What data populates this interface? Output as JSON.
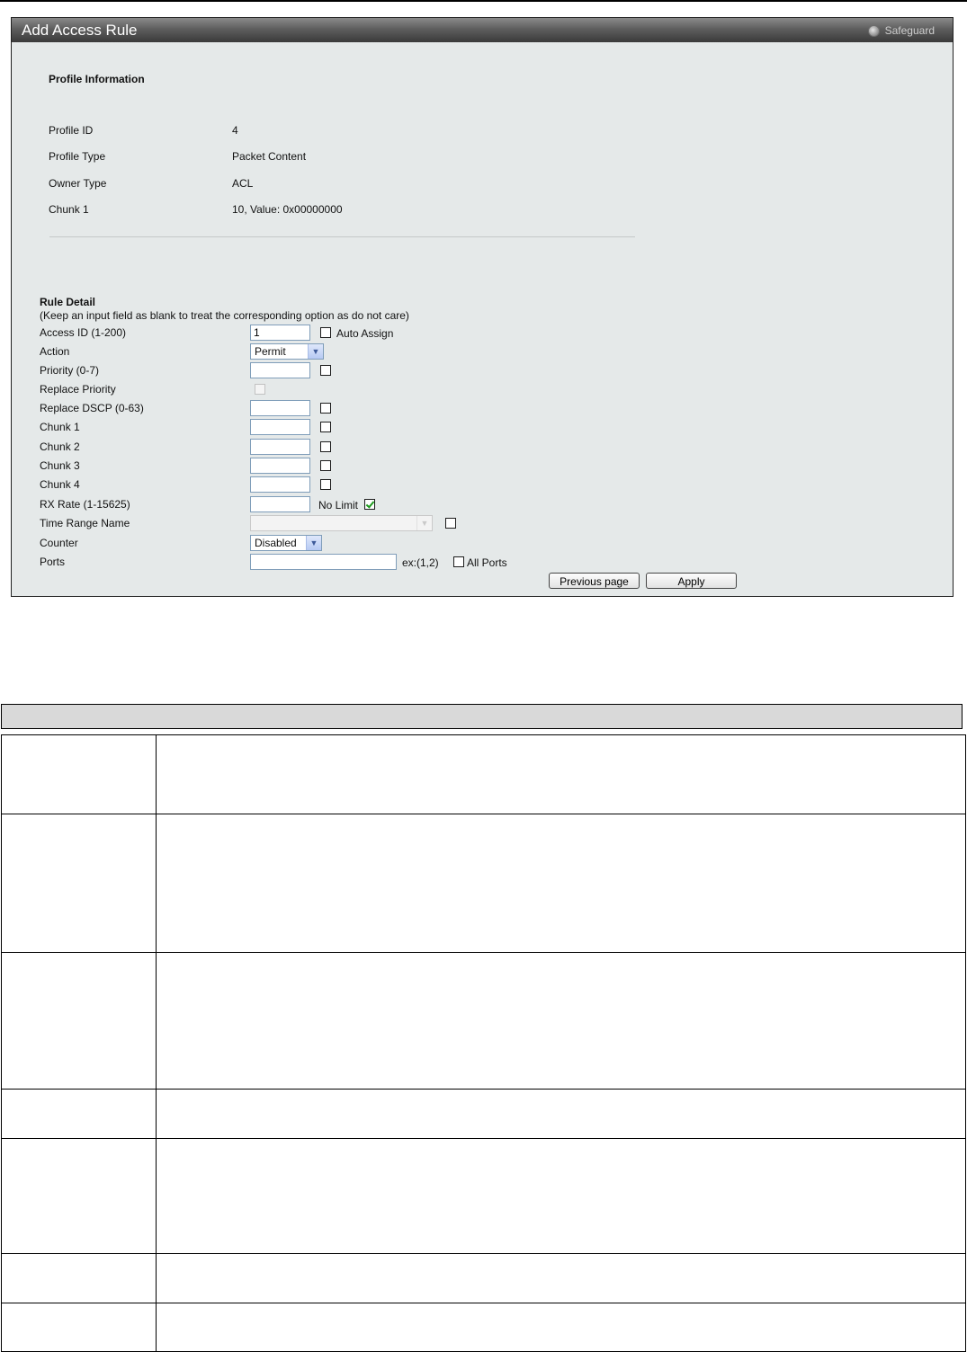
{
  "window": {
    "title": "Add Access Rule",
    "safeguard_label": "Safeguard"
  },
  "profile_info": {
    "heading": "Profile Information",
    "rows": [
      {
        "label": "Profile ID",
        "value": "4"
      },
      {
        "label": "Profile Type",
        "value": "Packet Content"
      },
      {
        "label": "Owner Type",
        "value": "ACL"
      },
      {
        "label": "Chunk 1",
        "value": "10, Value: 0x00000000"
      }
    ]
  },
  "rule_detail": {
    "heading": "Rule Detail",
    "note": "(Keep an input field as blank to treat the corresponding option as do not care)",
    "access_id": {
      "label": "Access ID (1-200)",
      "value": "1",
      "auto_assign_label": "Auto Assign",
      "auto_assign_checked": false
    },
    "action": {
      "label": "Action",
      "selected": "Permit"
    },
    "priority": {
      "label": "Priority  (0-7)",
      "value": ""
    },
    "replace_priority": {
      "label": "Replace Priority"
    },
    "replace_dscp": {
      "label": "Replace DSCP  (0-63)",
      "value": ""
    },
    "chunks": [
      {
        "label": "Chunk 1",
        "value": ""
      },
      {
        "label": "Chunk 2",
        "value": ""
      },
      {
        "label": "Chunk 3",
        "value": ""
      },
      {
        "label": "Chunk 4",
        "value": ""
      }
    ],
    "rx_rate": {
      "label": "RX Rate  (1-15625)",
      "value": "",
      "no_limit_label": "No Limit",
      "no_limit_checked": true
    },
    "time_range": {
      "label": "Time Range Name",
      "selected": ""
    },
    "counter": {
      "label": "Counter",
      "selected": "Disabled"
    },
    "ports": {
      "label": "Ports",
      "value": "",
      "example": "ex:(1,2)",
      "all_ports_label": "All Ports"
    }
  },
  "buttons": {
    "previous": "Previous page",
    "apply": "Apply"
  },
  "description_table": {
    "header": "",
    "rows": 7
  }
}
